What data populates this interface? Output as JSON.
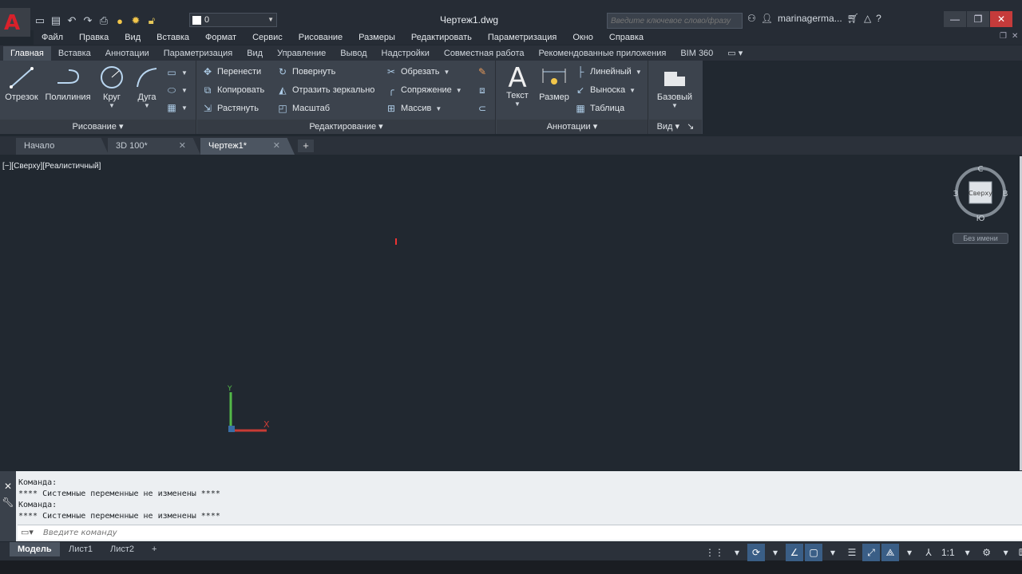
{
  "app": {
    "logo_letter": "A",
    "document_title": "Чертеж1.dwg",
    "search_placeholder": "Введите ключевое слово/фразу",
    "user_name": "marinagerma...",
    "layer_name": "0"
  },
  "menu": [
    "Файл",
    "Правка",
    "Вид",
    "Вставка",
    "Формат",
    "Сервис",
    "Рисование",
    "Размеры",
    "Редактировать",
    "Параметризация",
    "Окно",
    "Справка"
  ],
  "ribbon_tabs": [
    "Главная",
    "Вставка",
    "Аннотации",
    "Параметризация",
    "Вид",
    "Управление",
    "Вывод",
    "Надстройки",
    "Совместная работа",
    "Рекомендованные приложения",
    "BIM 360"
  ],
  "ribbon": {
    "draw": {
      "title": "Рисование",
      "line": "Отрезок",
      "polyline": "Полилиния",
      "circle": "Круг",
      "arc": "Дуга"
    },
    "modify": {
      "title": "Редактирование",
      "move": "Перенести",
      "rotate": "Повернуть",
      "trim": "Обрезать",
      "copy": "Копировать",
      "mirror": "Отразить зеркально",
      "fillet": "Сопряжение",
      "stretch": "Растянуть",
      "scale": "Масштаб",
      "array": "Массив"
    },
    "annotation": {
      "title": "Аннотации",
      "text": "Текст",
      "dimension": "Размер",
      "linear": "Линейный",
      "leader": "Выноска",
      "table": "Таблица"
    },
    "view": {
      "title": "Вид",
      "base": "Базовый"
    }
  },
  "file_tabs": [
    {
      "label": "Начало"
    },
    {
      "label": "3D 100*"
    },
    {
      "label": "Чертеж1*"
    }
  ],
  "viewport": {
    "label": "[−][Сверху][Реалистичный]",
    "viewcube": {
      "top_face": "Сверху",
      "north": "С",
      "south": "Ю",
      "west": "З",
      "east": "В",
      "ucs_name": "Без имени"
    },
    "ucs": {
      "x": "X",
      "y": "Y"
    }
  },
  "command": {
    "history": [
      "Команда:",
      "**** Системные переменные не изменены ****",
      "Команда:",
      "**** Системные переменные не изменены ****"
    ],
    "placeholder": "Введите команду"
  },
  "layout_tabs": [
    "Модель",
    "Лист1",
    "Лист2"
  ],
  "status": {
    "scale": "1:1"
  },
  "colors": {
    "accent": "#3a5e86",
    "logo": "#d8212b",
    "background": "#212830"
  }
}
